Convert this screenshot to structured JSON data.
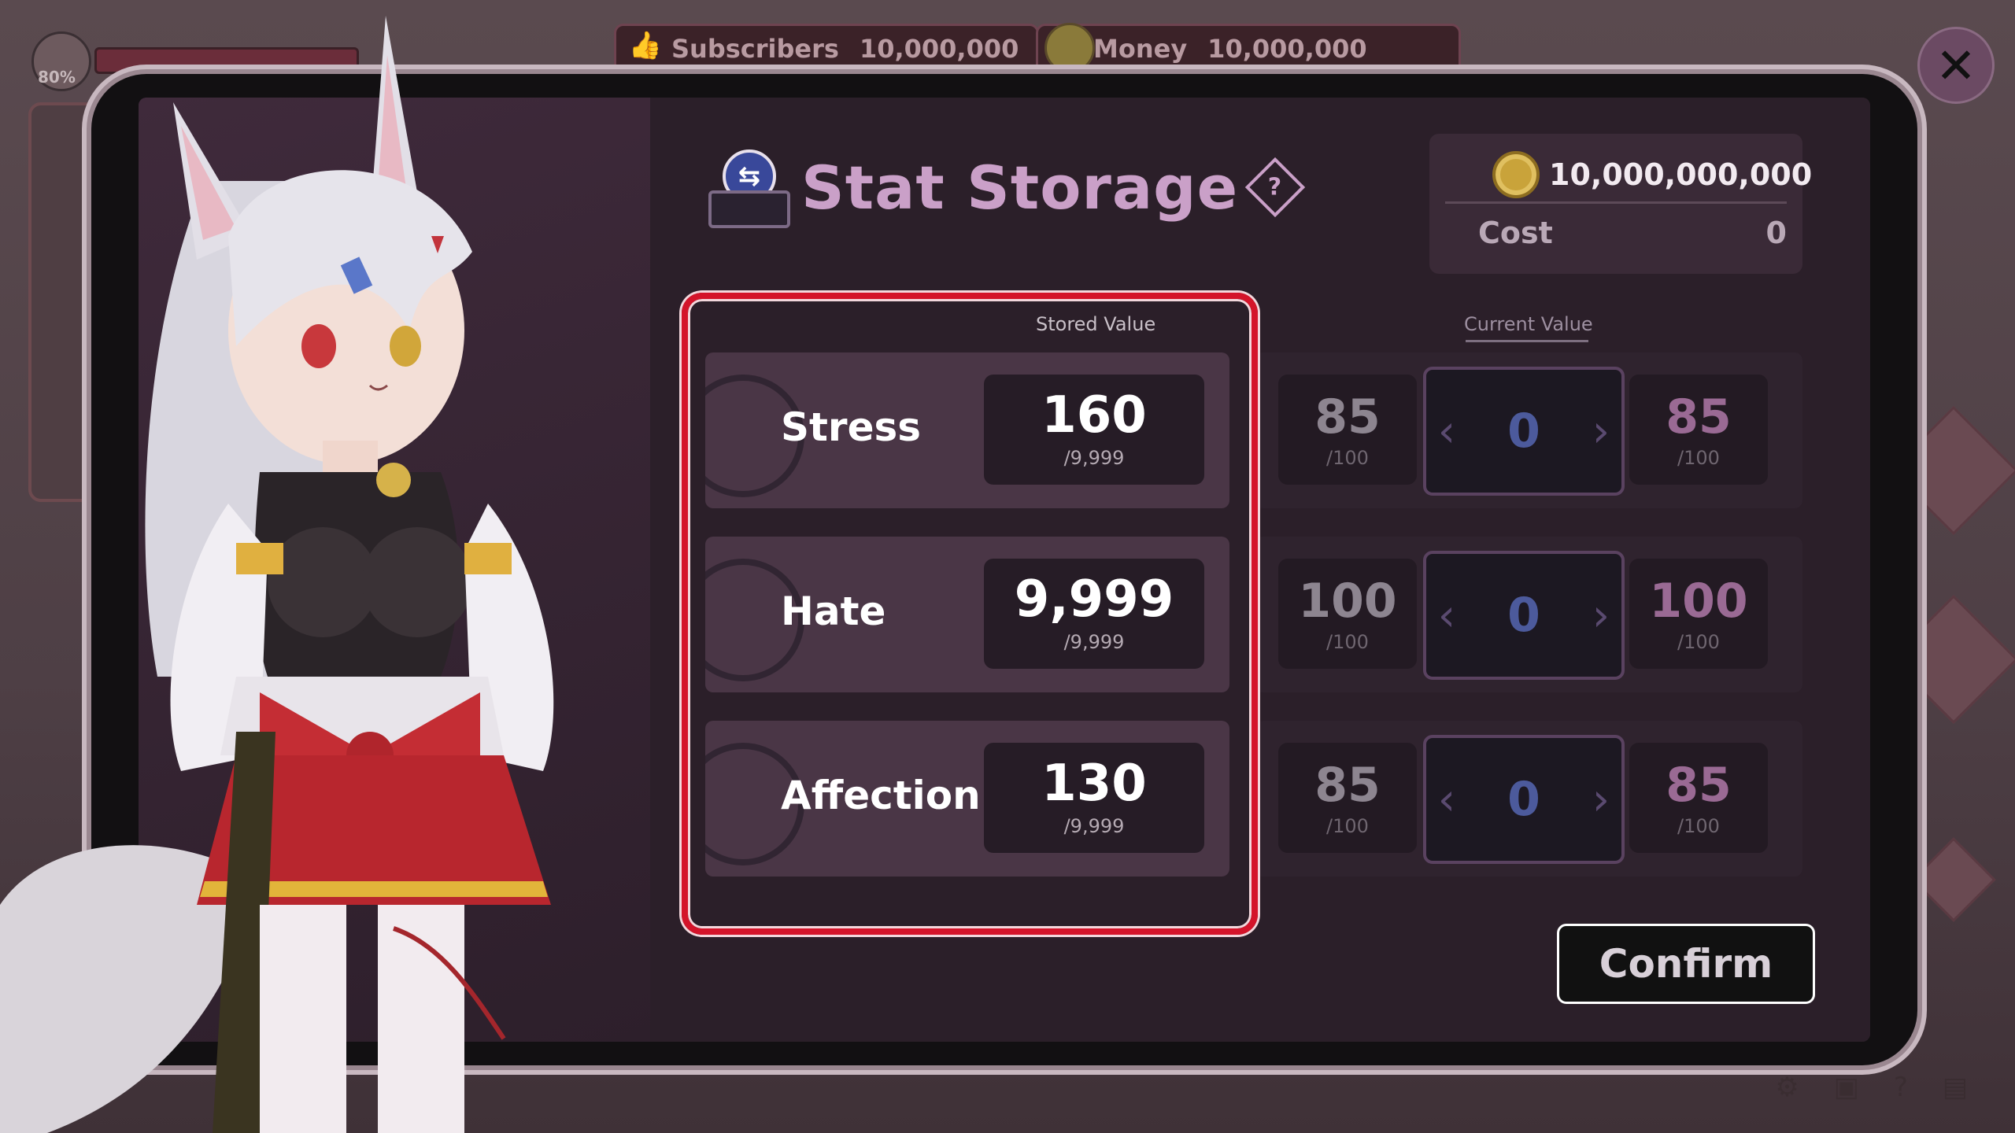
{
  "hud": {
    "meter_percent": "80%",
    "subscribers_label": "Subscribers",
    "subscribers_value": "10,000,000",
    "money_label": "Money",
    "money_value": "10,000,000"
  },
  "dialog": {
    "title": "Stat Storage",
    "help_glyph": "?",
    "close_glyph": "✕",
    "balance": "10,000,000,000",
    "cost_label": "Cost",
    "cost_value": "0",
    "stored_header": "Stored Value",
    "current_header": "Current Value",
    "confirm_label": "Confirm",
    "stats": [
      {
        "name": "Stress",
        "stored": "160",
        "stored_max": "/9,999",
        "current": "85",
        "current_max": "/100",
        "delta": "0",
        "result": "85",
        "result_max": "/100"
      },
      {
        "name": "Hate",
        "stored": "9,999",
        "stored_max": "/9,999",
        "current": "100",
        "current_max": "/100",
        "delta": "0",
        "result": "100",
        "result_max": "/100"
      },
      {
        "name": "Affection",
        "stored": "130",
        "stored_max": "/9,999",
        "current": "85",
        "current_max": "/100",
        "delta": "0",
        "result": "85",
        "result_max": "/100"
      }
    ],
    "arrow_left": "‹",
    "arrow_right": "›"
  },
  "icons": {
    "title_icon": "stat-transfer-icon",
    "coin": "coin-icon",
    "thumbs": "thumbs-up-icon"
  },
  "colors": {
    "highlight": "#d4142a",
    "title": "#caa0c8",
    "stepper_value": "#4c5a9c"
  }
}
